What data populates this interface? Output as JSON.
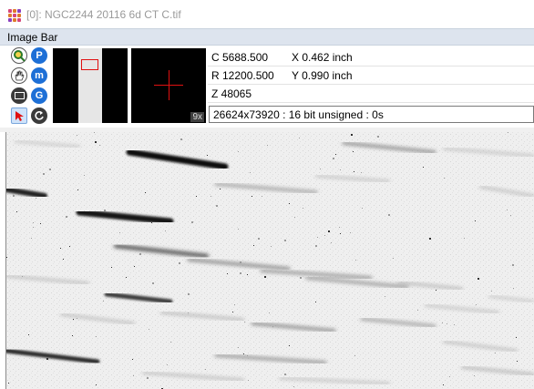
{
  "window": {
    "title": "[0]: NGC2244 20116 6d CT C.tif"
  },
  "image_bar": {
    "label": "Image Bar"
  },
  "tools": [
    {
      "name": "zoom",
      "glyph": "🔍"
    },
    {
      "name": "pan",
      "glyph": "P"
    },
    {
      "name": "hand",
      "glyph": "✋"
    },
    {
      "name": "measure",
      "glyph": "m"
    },
    {
      "name": "display",
      "glyph": "▭"
    },
    {
      "name": "info",
      "glyph": "G"
    },
    {
      "name": "pointer",
      "glyph": "➤"
    },
    {
      "name": "reset",
      "glyph": "↺"
    }
  ],
  "zoom_view": {
    "factor": "9x"
  },
  "readouts": {
    "c": "C 5688.500",
    "x": "X 0.462 inch",
    "r": "R 12200.500",
    "y": "Y 0.990 inch",
    "z": "Z 48065"
  },
  "info": "26624x73920 : 16 bit unsigned : 0s",
  "colors": {
    "accent_blue": "#1d6fd6",
    "roi_red": "#e01010",
    "bar_bg": "#dde4ee"
  }
}
